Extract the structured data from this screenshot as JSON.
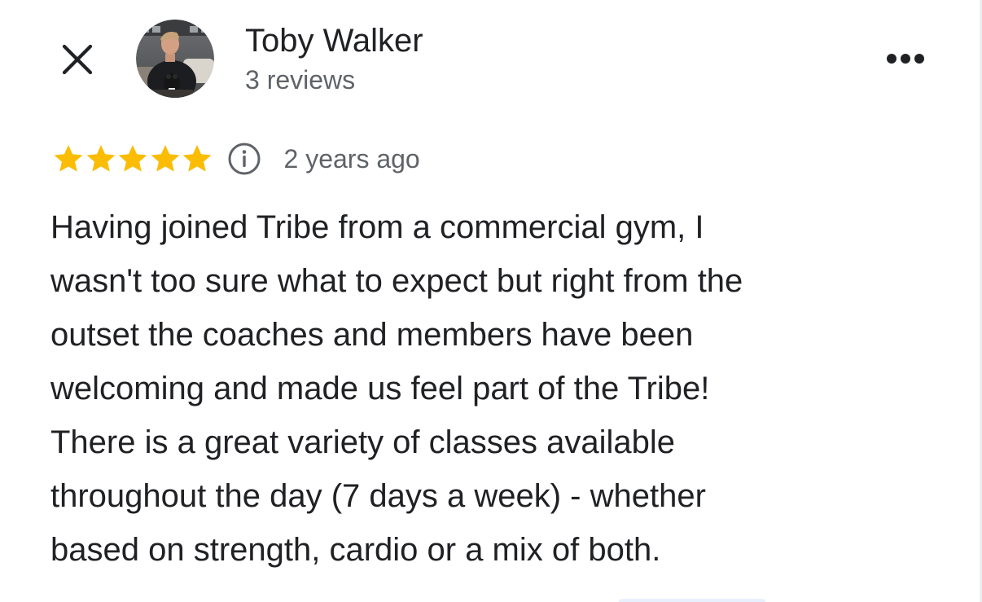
{
  "reviewer": {
    "name": "Toby Walker",
    "review_count": "3 reviews",
    "avatar_icon": "reviewer-avatar-photo"
  },
  "header": {
    "close_icon": "close-icon",
    "more_icon": "more-horiz-icon"
  },
  "review": {
    "rating": 5,
    "max_rating": 5,
    "star_color": "#fbbc04",
    "info_icon": "info-icon",
    "date": "2 years ago",
    "text": "Having joined Tribe from a commercial gym, I\nwasn't too sure what to expect but right from the\noutset the coaches and members have been\nwelcoming and made us feel part of the Tribe!\nThere is a great variety of classes available\nthroughout the day (7 days a week) - whether\nbased on strength, cardio or a mix of both."
  },
  "colors": {
    "primary_text": "#202124",
    "secondary_text": "#5f6368",
    "icon": "#202124"
  }
}
